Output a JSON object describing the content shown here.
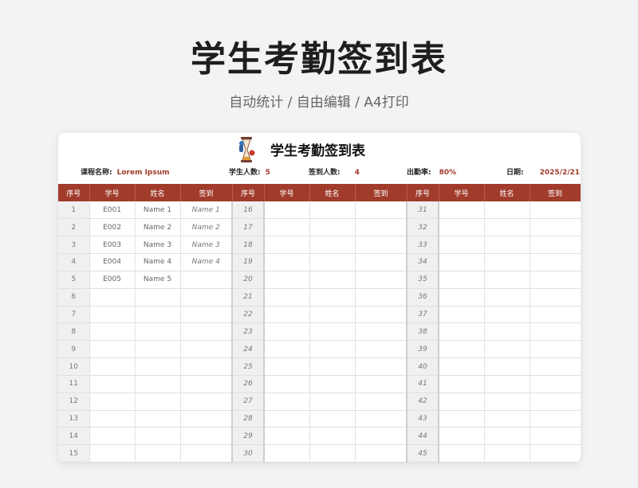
{
  "hero": {
    "title": "学生考勤签到表",
    "subtitle": "自动统计 / 自由编辑 / A4打印"
  },
  "sheet": {
    "title": "学生考勤签到表",
    "icon": "hourglass-icon",
    "info": {
      "course_label": "课程名称:",
      "course_value": "Lorem Ipsum",
      "students_label": "学生人数:",
      "students_value": "5",
      "signed_label": "签到人数:",
      "signed_value": "4",
      "rate_label": "出勤率:",
      "rate_value": "80%",
      "date_label": "日期:",
      "date_value": "2025/2/21"
    },
    "headers": [
      "序号",
      "学号",
      "姓名",
      "签到",
      "序号",
      "学号",
      "姓名",
      "签到",
      "序号",
      "学号",
      "姓名",
      "签到"
    ],
    "rows": [
      {
        "seq1": "1",
        "id1": "E001",
        "name1": "Name 1",
        "sign1": "Name 1",
        "seq2": "16",
        "seq3": "31"
      },
      {
        "seq1": "2",
        "id1": "E002",
        "name1": "Name 2",
        "sign1": "Name 2",
        "seq2": "17",
        "seq3": "32"
      },
      {
        "seq1": "3",
        "id1": "E003",
        "name1": "Name 3",
        "sign1": "Name 3",
        "seq2": "18",
        "seq3": "33"
      },
      {
        "seq1": "4",
        "id1": "E004",
        "name1": "Name 4",
        "sign1": "Name 4",
        "seq2": "19",
        "seq3": "34"
      },
      {
        "seq1": "5",
        "id1": "E005",
        "name1": "Name 5",
        "sign1": "",
        "seq2": "20",
        "seq3": "35"
      },
      {
        "seq1": "6",
        "id1": "",
        "name1": "",
        "sign1": "",
        "seq2": "21",
        "seq3": "36"
      },
      {
        "seq1": "7",
        "id1": "",
        "name1": "",
        "sign1": "",
        "seq2": "22",
        "seq3": "37"
      },
      {
        "seq1": "8",
        "id1": "",
        "name1": "",
        "sign1": "",
        "seq2": "23",
        "seq3": "38"
      },
      {
        "seq1": "9",
        "id1": "",
        "name1": "",
        "sign1": "",
        "seq2": "24",
        "seq3": "39"
      },
      {
        "seq1": "10",
        "id1": "",
        "name1": "",
        "sign1": "",
        "seq2": "25",
        "seq3": "40"
      },
      {
        "seq1": "11",
        "id1": "",
        "name1": "",
        "sign1": "",
        "seq2": "26",
        "seq3": "41"
      },
      {
        "seq1": "12",
        "id1": "",
        "name1": "",
        "sign1": "",
        "seq2": "27",
        "seq3": "42"
      },
      {
        "seq1": "13",
        "id1": "",
        "name1": "",
        "sign1": "",
        "seq2": "28",
        "seq3": "43"
      },
      {
        "seq1": "14",
        "id1": "",
        "name1": "",
        "sign1": "",
        "seq2": "29",
        "seq3": "44"
      },
      {
        "seq1": "15",
        "id1": "",
        "name1": "",
        "sign1": "",
        "seq2": "30",
        "seq3": "45"
      }
    ]
  }
}
